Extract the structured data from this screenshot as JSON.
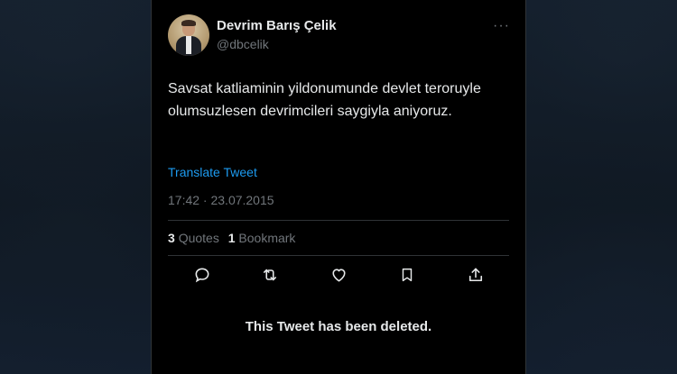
{
  "tweet": {
    "display_name": "Devrim Barış Çelik",
    "handle": "@dbcelik",
    "more_menu": "···",
    "text": "Savsat katliaminin yildonumunde devlet teroruyle olumsuzlesen devrimcileri saygiyla aniyoruz.",
    "translate_label": "Translate Tweet",
    "timestamp": "17:42 · 23.07.2015",
    "stats": {
      "quotes_count": "3",
      "quotes_label": "Quotes",
      "bookmarks_count": "1",
      "bookmarks_label": "Bookmark"
    },
    "actions": [
      {
        "icon": "reply-icon"
      },
      {
        "icon": "retweet-icon"
      },
      {
        "icon": "like-icon"
      },
      {
        "icon": "bookmark-icon"
      },
      {
        "icon": "share-icon"
      }
    ],
    "deleted_notice": "This Tweet has been deleted."
  },
  "colors": {
    "background": "#000000",
    "primary_text": "#e7e9ea",
    "secondary_text": "#71767b",
    "link": "#1d9bf0",
    "divider": "#2f3336"
  }
}
